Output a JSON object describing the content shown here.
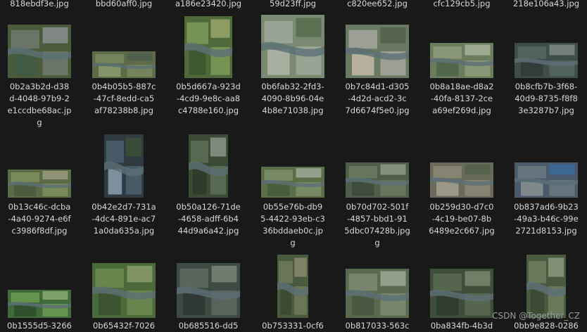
{
  "app": "File Explorer - Large icons view",
  "top_row_labels": [
    "818ebdf3e.jpg",
    "bbd60aff0.jpg",
    "a186e23420.jpg",
    "59d23ff.jpg",
    "c820ee652.jpg",
    "cfc129cb5.jpg",
    "218e106a43.jpg"
  ],
  "rows": [
    [
      {
        "name": "0b2a3b2d-d38d-4048-97b9-2e1ccdbe68ac.jpg",
        "lines": "0b2a3b2d-d38\nd-4048-97b9-2\ne1ccdbe68ac.jp\ng",
        "img": {
          "w": 90,
          "h": 76,
          "colors": [
            "#4a5a3a",
            "#6e7a6e",
            "#8a8f90",
            "#3f5a45"
          ]
        }
      },
      {
        "name": "0b4b05b5-887c-47cf-8edd-ca5af78238b8.jpg",
        "lines": "0b4b05b5-887c\n-47cf-8edd-ca5\naf78238b8.jpg",
        "img": {
          "w": 90,
          "h": 38,
          "colors": [
            "#5d6b48",
            "#7a8860",
            "#4f5d50",
            "#8c9a70"
          ]
        }
      },
      {
        "name": "0b5d667a-923d-4cd9-9e8c-aa8c4788e160.jpg",
        "lines": "0b5d667a-923d\n-4cd9-9e8c-aa8\nc4788e160.jpg",
        "img": {
          "w": 68,
          "h": 88,
          "colors": [
            "#4e6a3a",
            "#7d9a5a",
            "#9aa36b",
            "#3a5530"
          ]
        }
      },
      {
        "name": "0b6fab32-2fd3-4090-8b96-04e4b8e71038.jpg",
        "lines": "0b6fab32-2fd3-\n4090-8b96-04e\n4b8e71038.jpg",
        "img": {
          "w": 90,
          "h": 90,
          "colors": [
            "#7a8a72",
            "#9fa89a",
            "#556b4a",
            "#b0b4a8"
          ]
        }
      },
      {
        "name": "0b7c84d1-d305-4d2d-acd2-3c7d6674f5e0.jpg",
        "lines": "0b7c84d1-d305\n-4d2d-acd2-3c\n7d6674f5e0.jpg",
        "img": {
          "w": 90,
          "h": 76,
          "colors": [
            "#6a7a62",
            "#a5a79d",
            "#50604a",
            "#c2b8a8"
          ]
        }
      },
      {
        "name": "0b8a18ae-d8a2-40fa-8137-2cea69ef269d.jpg",
        "lines": "0b8a18ae-d8a2\n-40fa-8137-2ce\na69ef269d.jpg",
        "img": {
          "w": 90,
          "h": 50,
          "colors": [
            "#6b7d5d",
            "#8d9b7a",
            "#a9b09a",
            "#4e6248"
          ]
        }
      },
      {
        "name": "0b8cfb7b-3f68-40d9-8735-f8f83e3287b7.jpg",
        "lines": "0b8cfb7b-3f68-\n40d9-8735-f8f8\n3e3287b7.jpg",
        "img": {
          "w": 90,
          "h": 50,
          "colors": [
            "#3e4c4a",
            "#566663",
            "#7c8a86",
            "#2f3a38"
          ]
        }
      }
    ],
    [
      {
        "name": "0b13c46c-dcba-4a40-9274-e6fc3986f8df.jpg",
        "lines": "0b13c46c-dcba\n-4a40-9274-e6f\nc3986f8df.jpg",
        "img": {
          "w": 90,
          "h": 40,
          "colors": [
            "#5a6b45",
            "#7e8f5e",
            "#9a9a80",
            "#4a5a3e"
          ]
        }
      },
      {
        "name": "0b42e2d7-731a-4dc4-891e-ac71a0da635a.jpg",
        "lines": "0b42e2d7-731a\n-4dc4-891e-ac7\n1a0da635a.jpg",
        "img": {
          "w": 56,
          "h": 90,
          "colors": [
            "#2e3a40",
            "#4a6070",
            "#3d4f3a",
            "#8aa0b0"
          ]
        }
      },
      {
        "name": "0b50a126-71de-4658-adff-6b444d9a6a42.jpg",
        "lines": "0b50a126-71de\n-4658-adff-6b4\n44d9a6a42.jpg",
        "img": {
          "w": 56,
          "h": 90,
          "colors": [
            "#3a4a34",
            "#5e6e58",
            "#8a9488",
            "#2e3a2c"
          ]
        }
      },
      {
        "name": "0b55e76b-db95-4422-93eb-c336bddaeb0c.jpg",
        "lines": "0b55e76b-db9\n5-4422-93eb-c3\n36bddaeb0c.jp\ng",
        "img": {
          "w": 90,
          "h": 44,
          "colors": [
            "#5a6e48",
            "#7c8f6a",
            "#a0a89a",
            "#485a3c"
          ]
        }
      },
      {
        "name": "0b70d702-501f-4857-bbd1-915dbc07428b.jpg",
        "lines": "0b70d702-501f\n-4857-bbd1-91\n5dbc07428b.jpg\ng",
        "img": {
          "w": 90,
          "h": 50,
          "colors": [
            "#4e5e48",
            "#6a7a62",
            "#8f9a88",
            "#3c4a3a"
          ]
        }
      },
      {
        "name": "0b259d30-d7c0-4c19-be07-8b6489e2c667.jpg",
        "lines": "0b259d30-d7c0\n-4c19-be07-8b\n6489e2c667.jpg",
        "img": {
          "w": 90,
          "h": 50,
          "colors": [
            "#6a6a5a",
            "#8a8878",
            "#54604a",
            "#a4a090"
          ]
        }
      },
      {
        "name": "0b837ad6-9b23-49a3-b46c-99e2721d8153.jpg",
        "lines": "0b837ad6-9b23\n-49a3-b46c-99e\n2721d8153.jpg",
        "img": {
          "w": 90,
          "h": 50,
          "colors": [
            "#4a5a6a",
            "#6a7a80",
            "#3a6a9a",
            "#8a9090"
          ]
        }
      }
    ],
    [
      {
        "name": "0b1555d5-3266",
        "lines": "0b1555d5-3266",
        "img": {
          "w": 90,
          "h": 40,
          "colors": [
            "#3f6a3a",
            "#6a9a50",
            "#8aa870",
            "#2e4a2a"
          ]
        }
      },
      {
        "name": "0b65432f-7026",
        "lines": "0b65432f-7026",
        "img": {
          "w": 90,
          "h": 78,
          "colors": [
            "#4a6a3a",
            "#6e8a52",
            "#8a9a6a",
            "#3a5030"
          ]
        }
      },
      {
        "name": "0b685516-dd5",
        "lines": "0b685516-dd5",
        "img": {
          "w": 90,
          "h": 78,
          "colors": [
            "#3e4a44",
            "#5e6a60",
            "#7a8478",
            "#2c3630"
          ]
        }
      },
      {
        "name": "0b753331-0cf6",
        "lines": "0b753331-0cf6",
        "img": {
          "w": 44,
          "h": 90,
          "colors": [
            "#4a5a3e",
            "#6e7a5a",
            "#8a8a70",
            "#3a4830"
          ]
        }
      },
      {
        "name": "0b817033-563c",
        "lines": "0b817033-563c",
        "img": {
          "w": 90,
          "h": 70,
          "colors": [
            "#5a6a50",
            "#7e8a72",
            "#a0a898",
            "#46563e"
          ]
        }
      },
      {
        "name": "0ba834fb-4b3d",
        "lines": "0ba834fb-4b3d",
        "img": {
          "w": 90,
          "h": 70,
          "colors": [
            "#3e4e3a",
            "#5a6a52",
            "#7a8a70",
            "#2e3a2c"
          ]
        }
      },
      {
        "name": "0bb9e828-0286",
        "lines": "0bb9e828-0286",
        "img": {
          "w": 56,
          "h": 90,
          "colors": [
            "#4a5a40",
            "#6e7e5e",
            "#8a9a7e",
            "#3a4a32"
          ]
        }
      }
    ]
  ],
  "watermark": "CSDN @Together_CZ"
}
